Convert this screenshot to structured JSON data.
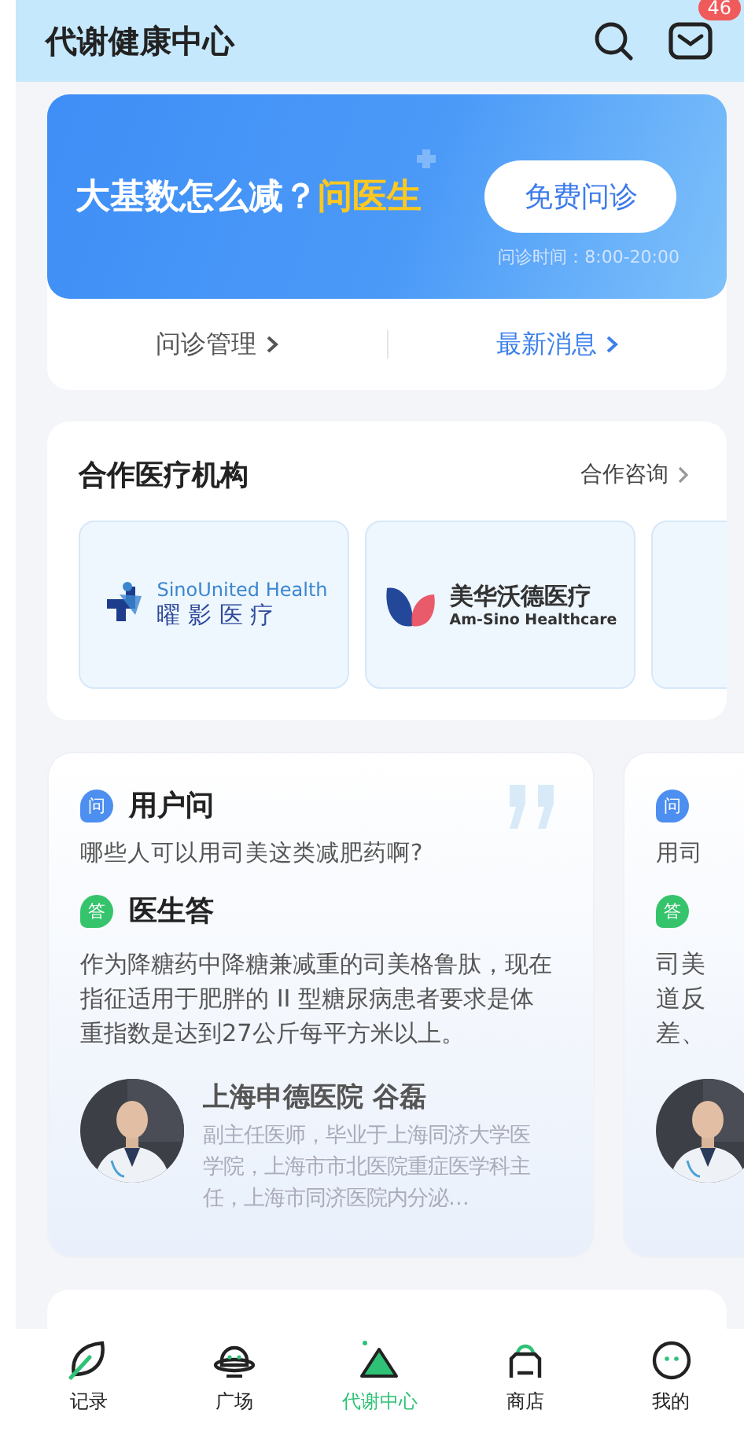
{
  "header": {
    "title": "代谢健康中心",
    "badge": "46"
  },
  "consult": {
    "headline": "大基数怎么减？",
    "highlight": "问医生",
    "button": "免费问诊",
    "hours": "问诊时间：8:00-20:00",
    "links": [
      {
        "label": "问诊管理",
        "kind": "plain"
      },
      {
        "label": "最新消息",
        "kind": "accent"
      }
    ]
  },
  "partners": {
    "title": "合作医疗机构",
    "more": "合作咨询",
    "items": [
      {
        "kind": "sino",
        "name_en": "SinoUnited Health",
        "name_cn": "曜 影 医 疗"
      },
      {
        "kind": "amsino",
        "name_cn": "美华沃德医疗",
        "name_en": "Am-Sino Healthcare"
      },
      {
        "kind": "blank"
      }
    ]
  },
  "qa": [
    {
      "question_icon": "问",
      "question_label": "用户问",
      "question": "哪些人可以用司美这类减肥药啊?",
      "answer_icon": "答",
      "answer_label": "医生答",
      "answer": "作为降糖药中降糖兼减重的司美格鲁肽，现在指征适用于肥胖的 II 型糖尿病患者要求是体重指数是达到27公斤每平方米以上。",
      "doctor": "上海申德医院 谷磊",
      "bio": "副主任医师，毕业于上海同济大学医学院，上海市市北医院重症医学科主任，上海市同济医院内分泌…"
    },
    {
      "question_icon": "问",
      "question": "用司",
      "answer_icon": "答",
      "answer_lines": [
        "司美",
        "道反",
        "差、"
      ]
    }
  ],
  "tabs": [
    {
      "label": "记录",
      "kind": "leaf",
      "selected": false
    },
    {
      "label": "广场",
      "kind": "planet",
      "selected": false
    },
    {
      "label": "代谢中心",
      "kind": "mountain",
      "selected": true
    },
    {
      "label": "商店",
      "kind": "bag",
      "selected": false
    },
    {
      "label": "我的",
      "kind": "face",
      "selected": false
    }
  ]
}
